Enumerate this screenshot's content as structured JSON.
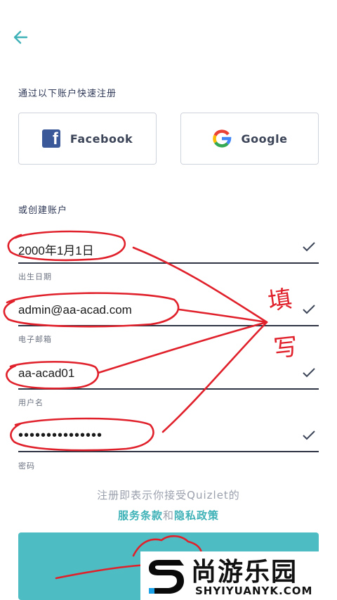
{
  "icons": {
    "back": "arrow-left-icon",
    "facebook": "facebook-icon",
    "google": "google-icon",
    "check": "check-icon"
  },
  "colors": {
    "accent": "#3fb2b7",
    "button": "#4dbdc3",
    "annotation": "#e0202a",
    "facebook": "#3b5998"
  },
  "quick_signup": {
    "title": "通过以下账户快速注册",
    "facebook_label": "Facebook",
    "google_label": "Google"
  },
  "create_account": {
    "title": "或创建账户",
    "fields": [
      {
        "value": "2000年1月1日",
        "label": "出生日期"
      },
      {
        "value": "admin@aa-acad.com",
        "label": "电子邮箱"
      },
      {
        "value": "aa-acad01",
        "label": "用户名"
      },
      {
        "value": "•••••••••••••••",
        "label": "密码"
      }
    ]
  },
  "terms": {
    "line1": "注册即表示你接受Quizlet的",
    "terms_link": "服务条款",
    "and": "和",
    "privacy_link": "隐私政策"
  },
  "annotations": {
    "char1": "填",
    "char2": "写"
  },
  "watermark": {
    "title": "尚游乐园",
    "subtitle": "SHYIYUANYK.COM",
    "logo_letter": "S"
  }
}
